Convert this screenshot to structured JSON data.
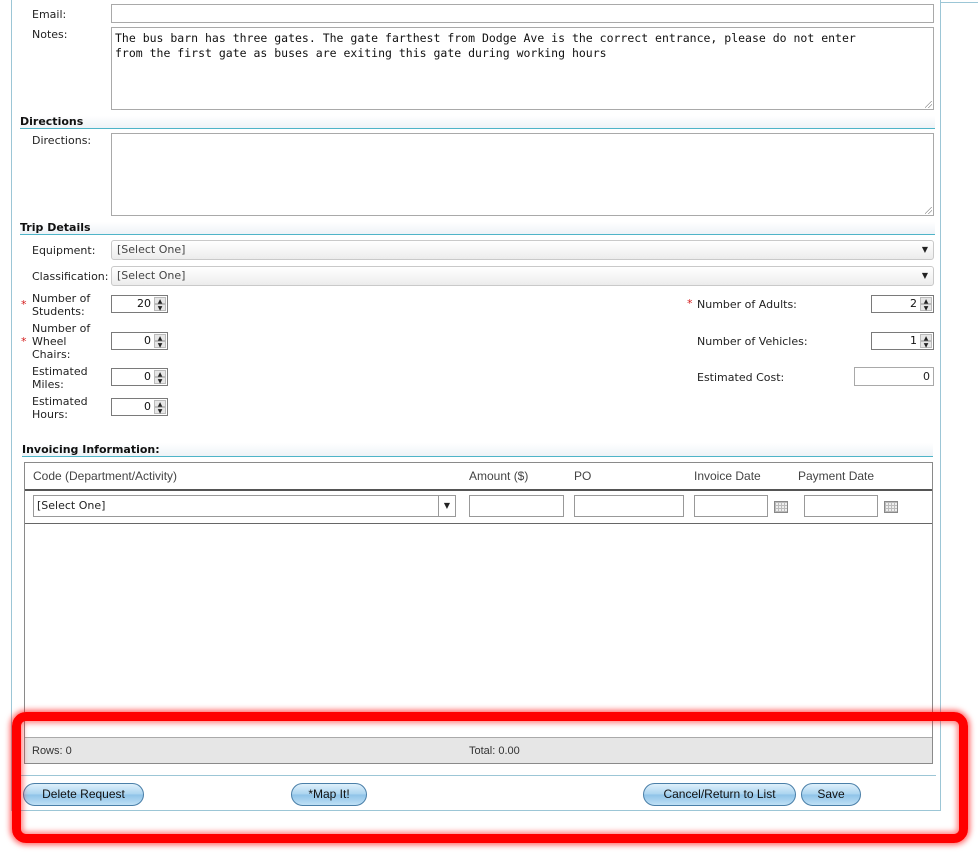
{
  "contact": {
    "email_label": "Email:",
    "email_value": "",
    "notes_label": "Notes:",
    "notes_value": "The bus barn has three gates. The gate farthest from Dodge Ave is the correct entrance, please do not enter\nfrom the first gate as buses are exiting this gate during working hours"
  },
  "directions": {
    "section_title": "Directions",
    "label": "Directions:",
    "value": ""
  },
  "trip_details": {
    "section_title": "Trip Details",
    "equipment_label": "Equipment:",
    "equipment_value": "[Select One]",
    "classification_label": "Classification:",
    "classification_value": "[Select One]",
    "students_label": "Number of Students:",
    "students_value": "20",
    "wheelchairs_label": "Number of Wheel Chairs:",
    "wheelchairs_value": "0",
    "miles_label": "Estimated Miles:",
    "miles_value": "0",
    "hours_label": "Estimated Hours:",
    "hours_value": "0",
    "adults_label": "Number of Adults:",
    "adults_value": "2",
    "vehicles_label": "Number of Vehicles:",
    "vehicles_value": "1",
    "cost_label": "Estimated Cost:",
    "cost_value": "0",
    "required_mark": "*"
  },
  "invoicing": {
    "section_title": "Invoicing Information:",
    "columns": [
      "Code (Department/Activity)",
      "Amount ($)",
      "PO",
      "Invoice Date",
      "Payment Date"
    ],
    "code_filter_value": "[Select One]",
    "rows_label": "Rows: 0",
    "total_label": "Total: 0.00"
  },
  "actions": {
    "delete": "Delete Request",
    "map": "*Map It!",
    "cancel": "Cancel/Return to List",
    "save": "Save"
  }
}
